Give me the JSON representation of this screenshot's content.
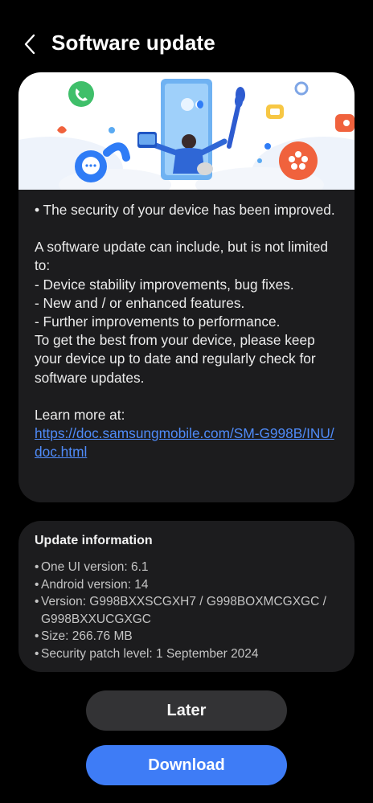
{
  "header": {
    "title": "Software update",
    "back_icon": "chevron-left-icon"
  },
  "banner": {
    "icons": [
      "phone-icon",
      "chat-bubble-icon",
      "flower-icon",
      "gear-icon",
      "message-icon",
      "paintbrush-icon",
      "person-illustration"
    ],
    "colors": {
      "green": "#3fbf6a",
      "blue": "#2f7cf6",
      "orange": "#f0623d",
      "yellow": "#f7c744",
      "sky": "#5aaaf2"
    }
  },
  "notes": {
    "intro": "• The security of your device has been improved.",
    "includes": "A software update can include, but is not limited to:",
    "items": [
      " - Device stability improvements, bug fixes.",
      " - New and / or enhanced features.",
      " - Further improvements to performance."
    ],
    "keep_up": "To get the best from your device, please keep your device up to date and regularly check for software updates.",
    "learn_more": "Learn more at:",
    "link": "https://doc.samsungmobile.com/SM-G998B/INU/doc.html"
  },
  "update_info": {
    "title": "Update information",
    "items": [
      "One UI version: 6.1",
      "Android version: 14",
      "Version: G998BXXSCGXH7 / G998BOXMCGXGC / G998BXXUCGXGC",
      "Size: 266.76 MB",
      "Security patch level: 1 September 2024"
    ]
  },
  "buttons": {
    "later": "Later",
    "download": "Download"
  },
  "colors": {
    "background": "#000000",
    "card": "#1c1c1e",
    "link": "#4f8bf9",
    "primary_button": "#3e7cf6",
    "secondary_button": "#333335"
  }
}
